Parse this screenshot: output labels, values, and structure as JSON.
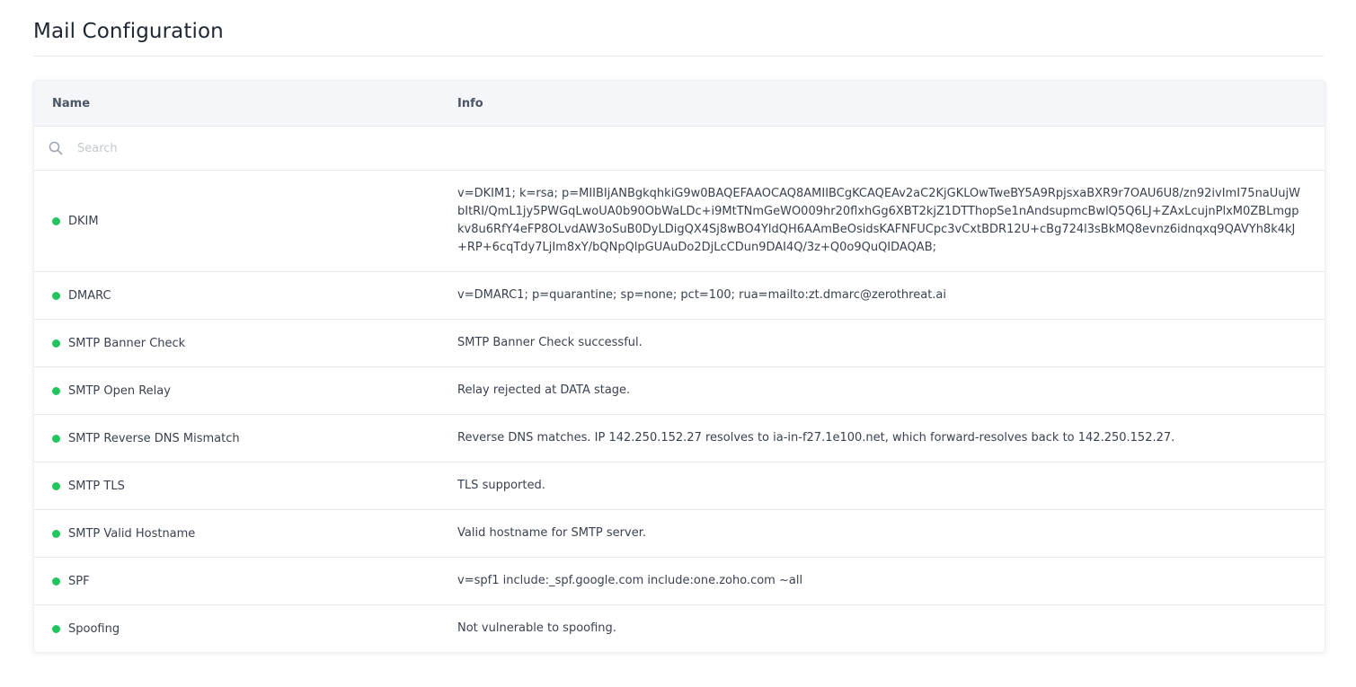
{
  "page": {
    "title": "Mail Configuration"
  },
  "table": {
    "columns": {
      "name": "Name",
      "info": "Info"
    },
    "search": {
      "placeholder": "Search",
      "value": ""
    },
    "status_color": "#22c55e",
    "rows": [
      {
        "name": "DKIM",
        "info": "v=DKIM1; k=rsa; p=MIIBIjANBgkqhkiG9w0BAQEFAAOCAQ8AMIIBCgKCAQEAv2aC2KjGKLOwTweBY5A9RpjsxaBXR9r7OAU6U8/zn92ivImI75naUujWbItRI/QmL1jy5PWGqLwoUA0b90ObWaLDc+i9MtTNmGeWO009hr20flxhGg6XBT2kjZ1DTThopSe1nAndsupmcBwlQ5Q6LJ+ZAxLcujnPlxM0ZBLmgpkv8u6RfY4eFP8OLvdAW3oSuB0DyLDigQX4Sj8wBO4YldQH6AAmBeOsidsKAFNFUCpc3vCxtBDR12U+cBg724l3sBkMQ8evnz6idnqxq9QAVYh8k4kJ+RP+6cqTdy7LjIm8xY/bQNpQlpGUAuDo2DjLcCDun9DAI4Q/3z+Q0o9QuQIDAQAB;"
      },
      {
        "name": "DMARC",
        "info": "v=DMARC1; p=quarantine; sp=none; pct=100; rua=mailto:zt.dmarc@zerothreat.ai"
      },
      {
        "name": "SMTP Banner Check",
        "info": "SMTP Banner Check successful."
      },
      {
        "name": "SMTP Open Relay",
        "info": "Relay rejected at DATA stage."
      },
      {
        "name": "SMTP Reverse DNS Mismatch",
        "info": "Reverse DNS matches. IP 142.250.152.27 resolves to ia-in-f27.1e100.net, which forward-resolves back to 142.250.152.27."
      },
      {
        "name": "SMTP TLS",
        "info": "TLS supported."
      },
      {
        "name": "SMTP Valid Hostname",
        "info": "Valid hostname for SMTP server."
      },
      {
        "name": "SPF",
        "info": "v=spf1 include:_spf.google.com include:one.zoho.com ~all"
      },
      {
        "name": "Spoofing",
        "info": "Not vulnerable to spoofing."
      }
    ]
  }
}
